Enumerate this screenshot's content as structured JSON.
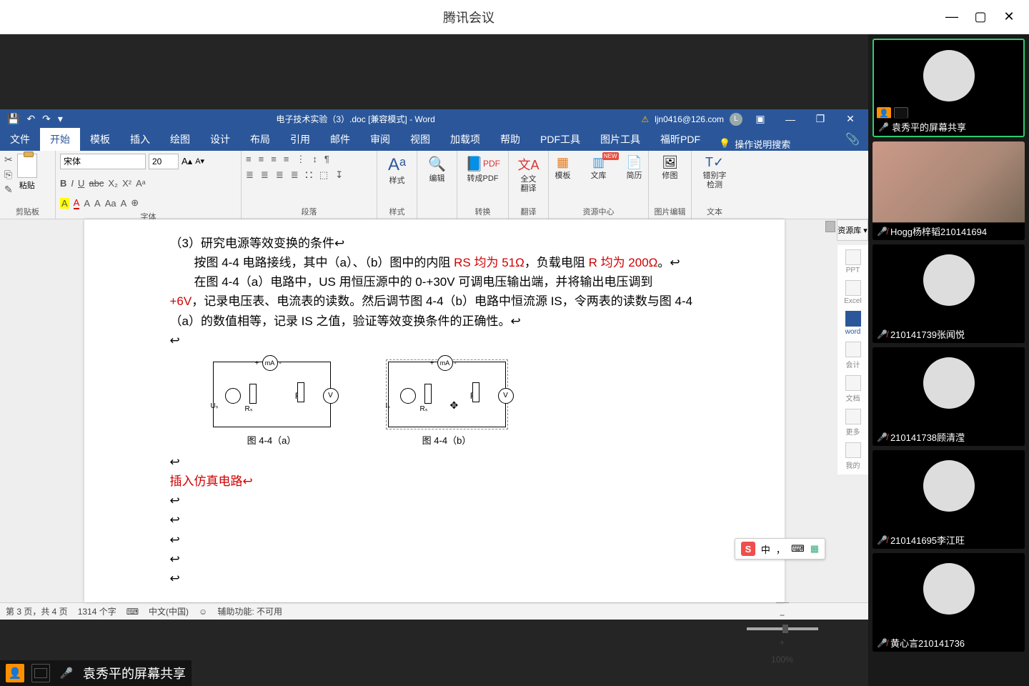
{
  "app": {
    "title": "腾讯会议",
    "min": "—",
    "max": "▢",
    "close": "✕"
  },
  "word": {
    "qat": {
      "save": "💾",
      "undo": "↶",
      "redo": "↷",
      "more": "▾"
    },
    "doc_title": "电子技术实验（3）.doc [兼容模式] - Word",
    "account": {
      "warn": "⚠",
      "email": "ljn0416@126.com",
      "avatar_letter": "L",
      "ribbon_opts": "▣",
      "min": "—",
      "restore": "❐",
      "close": "✕"
    },
    "tabs": [
      "文件",
      "开始",
      "模板",
      "插入",
      "绘图",
      "设计",
      "布局",
      "引用",
      "邮件",
      "审阅",
      "视图",
      "加载项",
      "帮助",
      "PDF工具",
      "图片工具",
      "福昕PDF"
    ],
    "active_tab": "开始",
    "tell_me": "操作说明搜索",
    "share_icon": "📎",
    "ribbon": {
      "clipboard": {
        "paste": "粘贴",
        "group": "剪贴板"
      },
      "font": {
        "family": "宋体",
        "size": "20",
        "group": "字体"
      },
      "font_btns_row1": [
        "B",
        "I",
        "U",
        "abc",
        "X₂",
        "X²",
        "Aᵃ"
      ],
      "font_btns_row2": [
        "A",
        "A",
        "A",
        "A",
        "Aa",
        "A",
        "⊕"
      ],
      "para": {
        "group": "段落"
      },
      "para_row1": [
        "≡",
        "≡",
        "≡",
        "≡",
        "⋮",
        "↕",
        "¶"
      ],
      "para_row2": [
        "≣",
        "≣",
        "≣",
        "≣",
        "⛚",
        "⬚",
        "↧"
      ],
      "styles": {
        "btn": "样式",
        "group": "样式"
      },
      "edit": {
        "btn": "编辑"
      },
      "convert_pdf": {
        "btn": "转成PDF",
        "group": "转换"
      },
      "fulltext": {
        "btn": "全文\n翻译",
        "group": "翻译"
      },
      "res_center": {
        "tpl": "模板",
        "lib": "文库",
        "cv": "简历",
        "new_badge": "NEW",
        "group": "资源中心"
      },
      "touchup": {
        "btn": "修图",
        "group": "图片编辑"
      },
      "ocr": {
        "btn": "错别字\n检测",
        "group": "文本"
      }
    },
    "doc": {
      "heading": "（3）研究电源等效变换的条件↩",
      "p1_a": "按图 4-4 电路接线，其中（a）、（b）图中的内阻 ",
      "p1_red": "RS 均为 51Ω",
      "p1_b": "，负载电阻 ",
      "p1_red2": "R 均为 200Ω",
      "p1_c": "。↩",
      "p2_a": "在图 4-4（a）电路中，US 用恒压源中的 0-+30V 可调电压输出端，并将输出电压调到",
      "p3_red": "+6V",
      "p3_a": "，记录电压表、电流表的读数。然后调节图 4-4（b）电路中恒流源 IS，令两表的读数与图 4-4（a）的数值相等，记录 IS 之值，验证等效变换条件的正确性。↩",
      "fig_a_cap": "图 4-4（a）",
      "fig_b_cap": "图 4-4（b）",
      "ma": "mA",
      "v": "V",
      "us": "Uₛ",
      "is": "Iₛ",
      "rs": "Rₛ",
      "insert_sim": "插入仿真电路↩"
    },
    "resource_panel": "资源库 ▾",
    "side": {
      "ppt": "PPT",
      "excel": "Excel",
      "word": "word",
      "acct": "会计",
      "wiki": "文档",
      "more": "更多",
      "mine": "我的"
    },
    "ime": {
      "logo": "S",
      "lang": "中",
      "punct": "，",
      "kb": "⌨",
      "grid": "▦"
    },
    "status": {
      "page": "第 3 页，共 4 页",
      "words": "1314 个字",
      "keyboard_icon": "⌨",
      "lang": "中文(中国)",
      "a11y_icon": "☺",
      "a11y": "辅助功能: 不可用",
      "zoom": "100%",
      "zoom_minus": "−",
      "zoom_plus": "+"
    }
  },
  "presenter": {
    "name": "袁秀平的屏幕共享"
  },
  "participants": [
    {
      "name": "袁秀平的屏幕共享",
      "mic": "on",
      "active": true,
      "badges": true,
      "avatar": "av-a"
    },
    {
      "name": "Hogg杨梓韬210141694",
      "mic": "muted",
      "photo": true
    },
    {
      "name": "210141739张闻悦",
      "mic": "muted",
      "avatar": "av-b"
    },
    {
      "name": "210141738顾清滢",
      "mic": "muted",
      "avatar": "av-c"
    },
    {
      "name": "210141695李江旺",
      "mic": "muted",
      "avatar": "av-d"
    },
    {
      "name": "黄心言210141736",
      "mic": "muted",
      "avatar": "av-e"
    }
  ]
}
